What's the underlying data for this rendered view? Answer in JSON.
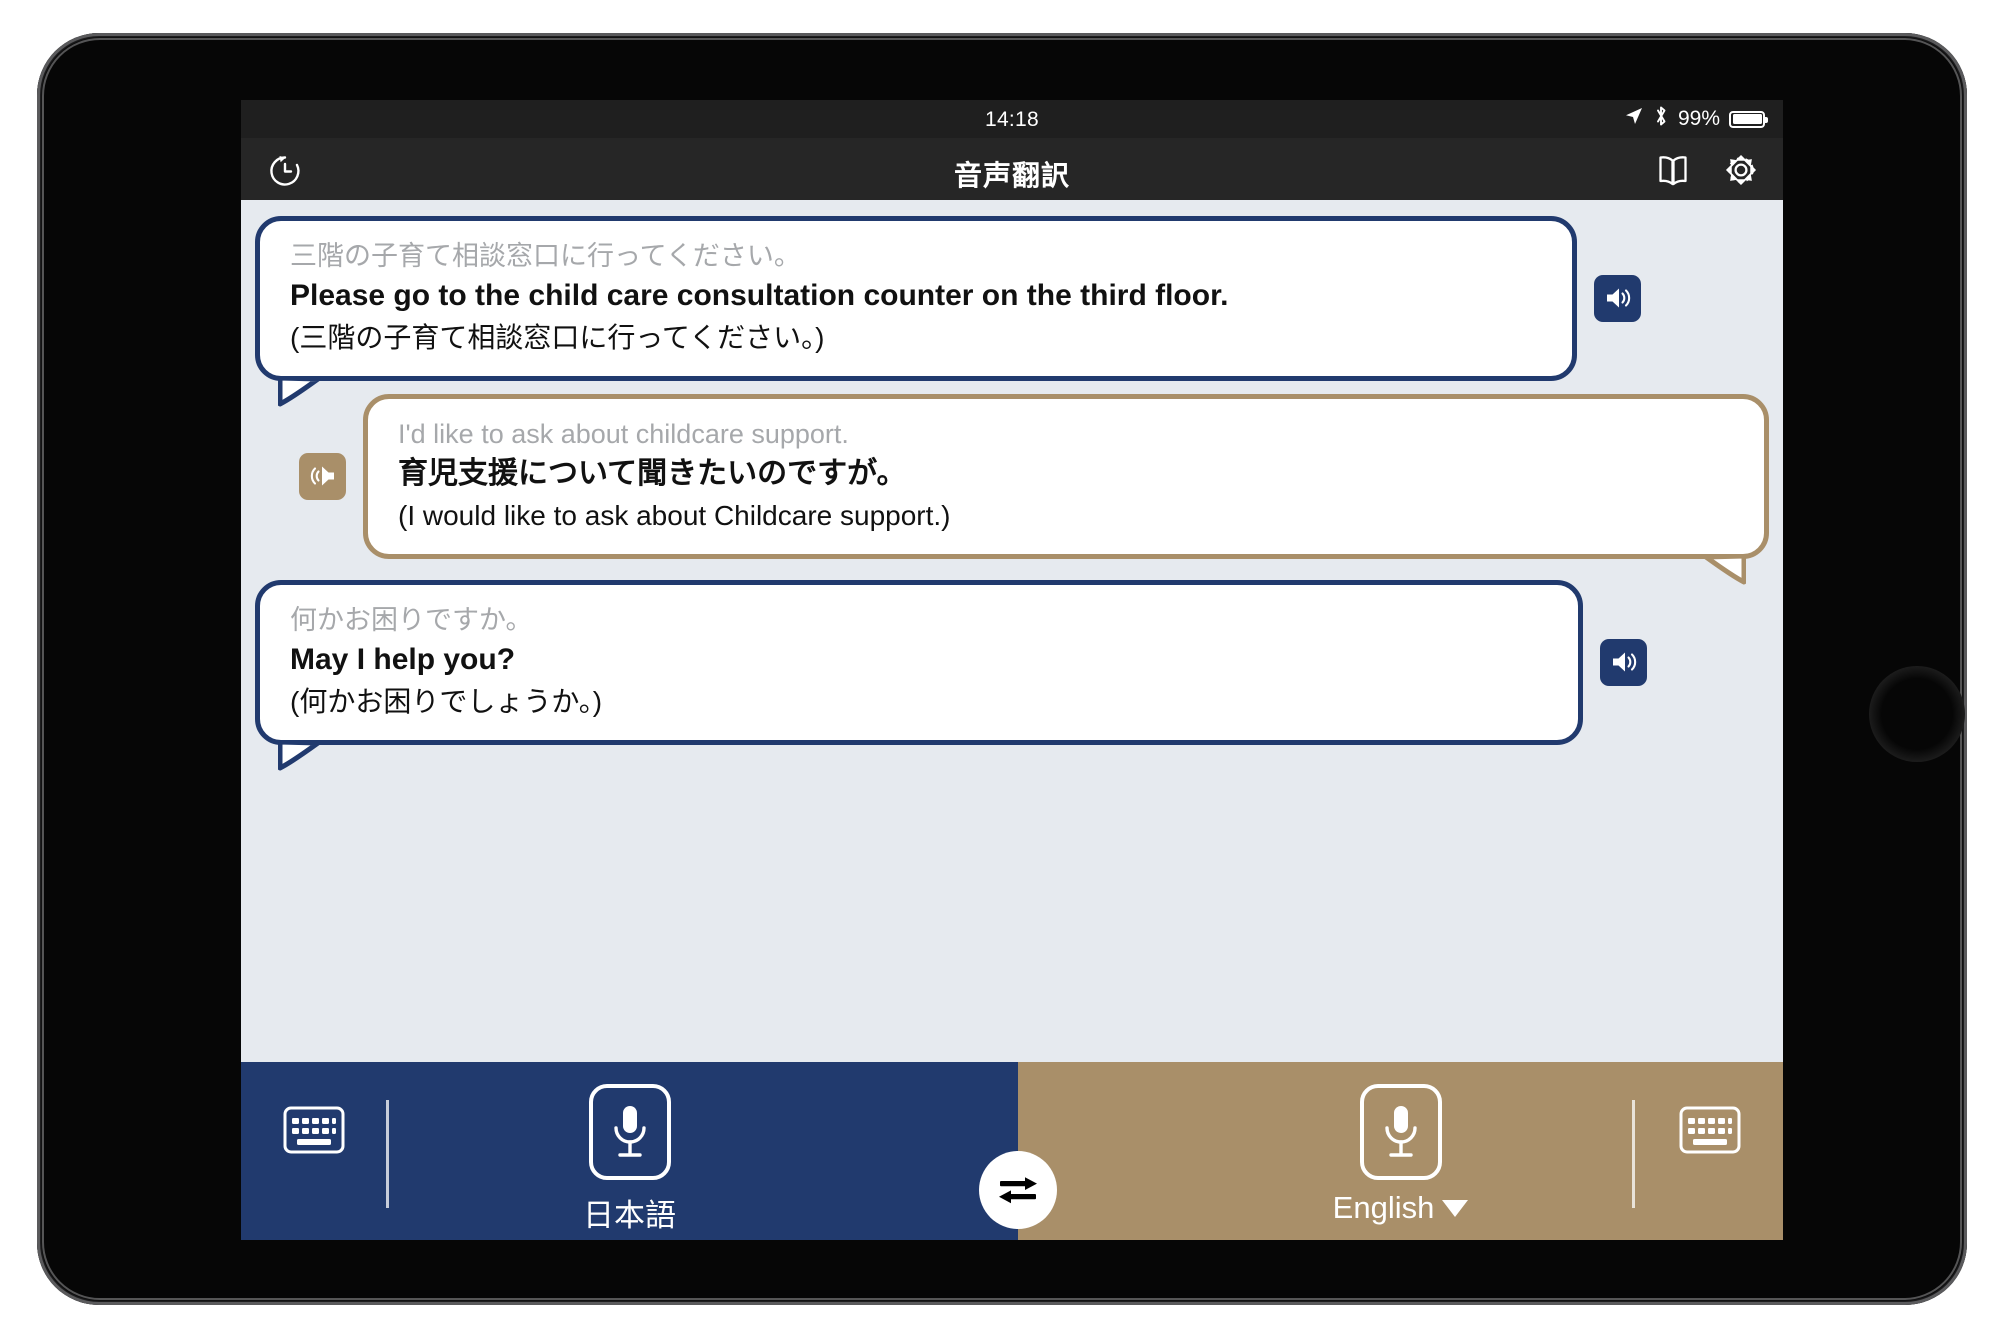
{
  "device": {
    "home_button_name": "home-button"
  },
  "status_bar": {
    "time": "14:18",
    "battery_percent": "99%",
    "icons": [
      "location-arrow-icon",
      "bluetooth-icon",
      "battery-icon"
    ]
  },
  "nav_bar": {
    "title": "音声翻訳",
    "history_icon": "history-clock-icon",
    "book_icon": "phrasebook-icon",
    "settings_icon": "gear-icon"
  },
  "conversation": {
    "messages": [
      {
        "id": "msg-1",
        "side": "left",
        "accent": "#213a6e",
        "accent_name": "navy",
        "source_text": "三階の子育て相談窓口に行ってください。",
        "translation_text": "Please go to the child care consultation counter on the third floor.",
        "back_translation_text": "(三階の子育て相談窓口に行ってください。)",
        "speaker_icon": "speaker-icon",
        "speaker_side": "right"
      },
      {
        "id": "msg-2",
        "side": "right",
        "accent": "#a98f69",
        "accent_name": "tan",
        "source_text": "I'd like to ask about childcare support.",
        "translation_text": "育児支援について聞きたいのですが。",
        "back_translation_text": "(I would like to ask about Childcare support.)",
        "speaker_icon": "speaker-icon",
        "speaker_side": "left"
      },
      {
        "id": "msg-3",
        "side": "left",
        "accent": "#213a6e",
        "accent_name": "navy",
        "source_text": "何かお困りですか。",
        "translation_text": "May I help you?",
        "back_translation_text": "(何かお困りでしょうか。)",
        "speaker_icon": "speaker-icon",
        "speaker_side": "right"
      }
    ]
  },
  "toolbar": {
    "source_panel": {
      "color": "#213a6e",
      "keyboard_icon": "keyboard-icon",
      "mic_icon": "microphone-icon",
      "language_label": "日本語",
      "has_dropdown": false
    },
    "target_panel": {
      "color": "#a98f69",
      "keyboard_icon": "keyboard-icon",
      "mic_icon": "microphone-icon",
      "language_label": "English",
      "has_dropdown": true,
      "dropdown_icon": "caret-down-icon"
    },
    "swap_button": {
      "icon": "swap-arrows-icon"
    }
  }
}
